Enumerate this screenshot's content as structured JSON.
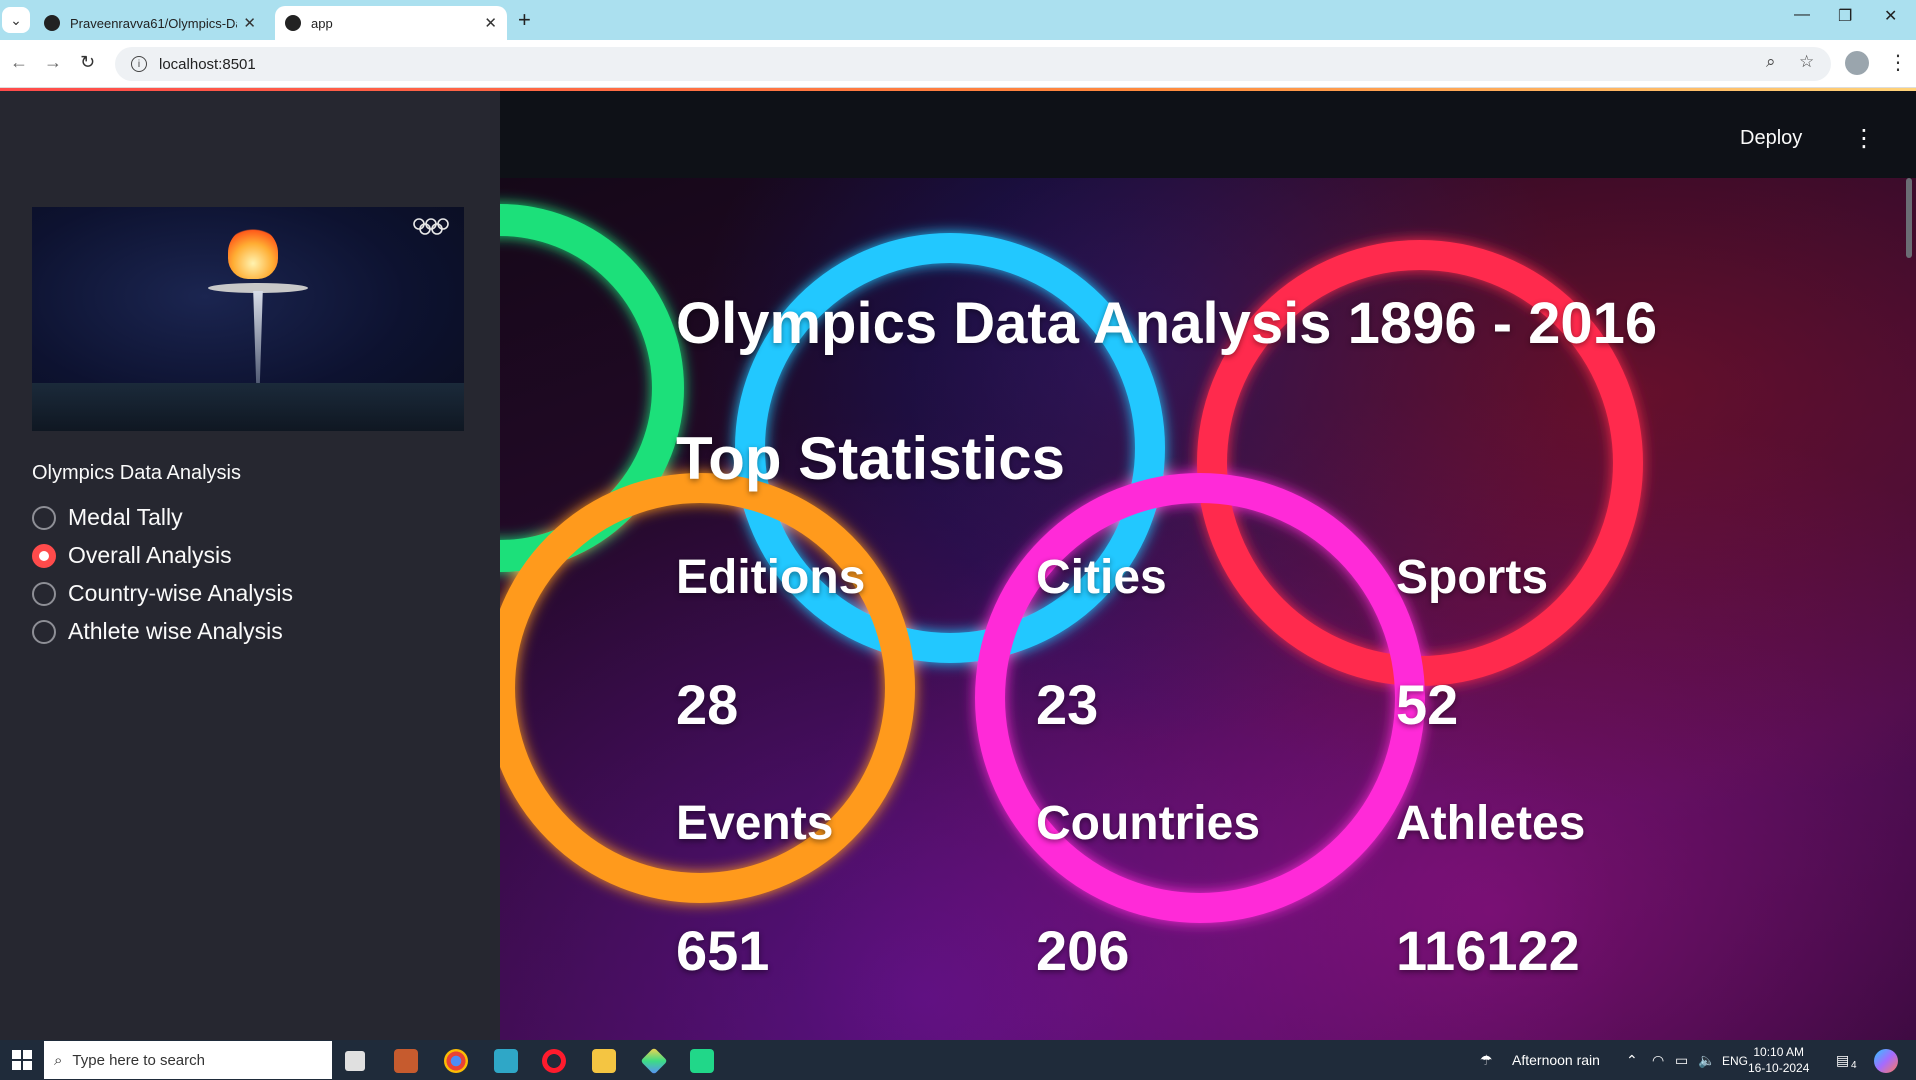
{
  "browser": {
    "tabs": [
      {
        "title": "Praveenravva61/Olympics-Data",
        "active": false
      },
      {
        "title": "app",
        "active": true
      }
    ],
    "address": "localhost:8501"
  },
  "app": {
    "deploy_label": "Deploy"
  },
  "sidebar": {
    "radio_label": "Olympics Data Analysis",
    "options": [
      {
        "label": "Medal Tally",
        "selected": false
      },
      {
        "label": "Overall Analysis",
        "selected": true
      },
      {
        "label": "Country-wise Analysis",
        "selected": false
      },
      {
        "label": "Athlete wise Analysis",
        "selected": false
      }
    ]
  },
  "main": {
    "title": "Olympics Data Analysis 1896 - 2016",
    "subtitle": "Top Statistics",
    "stats": [
      {
        "label": "Editions",
        "value": "28"
      },
      {
        "label": "Cities",
        "value": "23"
      },
      {
        "label": "Sports",
        "value": "52"
      },
      {
        "label": "Events",
        "value": "651"
      },
      {
        "label": "Countries",
        "value": "206"
      },
      {
        "label": "Athletes",
        "value": "116122"
      }
    ]
  },
  "taskbar": {
    "search_placeholder": "Type here to search",
    "weather": "Afternoon rain",
    "language": "ENG",
    "time": "10:10 AM",
    "date": "16-10-2024",
    "notification_count": "4"
  },
  "colors": {
    "accent": "#ff4b4b",
    "sidebar_bg": "#262730",
    "app_bg": "#0e1117"
  }
}
